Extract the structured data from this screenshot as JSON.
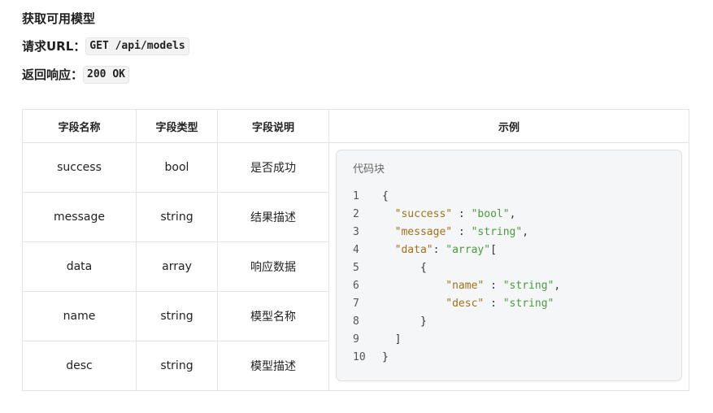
{
  "heading": "获取可用模型",
  "request": {
    "label": "请求URL：",
    "value": "GET /api/models"
  },
  "response": {
    "label": "返回响应：",
    "value": "200 OK"
  },
  "table": {
    "headers": [
      "字段名称",
      "字段类型",
      "字段说明",
      "示例"
    ],
    "rows": [
      [
        "success",
        "bool",
        "是否成功"
      ],
      [
        "message",
        "string",
        "结果描述"
      ],
      [
        "data",
        "array",
        "响应数据"
      ],
      [
        "name",
        "string",
        "模型名称"
      ],
      [
        "desc",
        "string",
        "模型描述"
      ]
    ]
  },
  "code_block": {
    "title": "代码块",
    "lines": [
      {
        "n": "1",
        "tokens": [
          {
            "t": "punc",
            "v": "{"
          }
        ]
      },
      {
        "n": "2",
        "tokens": [
          {
            "t": "punc",
            "v": "  "
          },
          {
            "t": "key",
            "v": "\"success\""
          },
          {
            "t": "punc",
            "v": " : "
          },
          {
            "t": "str",
            "v": "\"bool\""
          },
          {
            "t": "punc",
            "v": ","
          }
        ]
      },
      {
        "n": "3",
        "tokens": [
          {
            "t": "punc",
            "v": "  "
          },
          {
            "t": "key",
            "v": "\"message\""
          },
          {
            "t": "punc",
            "v": " : "
          },
          {
            "t": "str",
            "v": "\"string\""
          },
          {
            "t": "punc",
            "v": ","
          }
        ]
      },
      {
        "n": "4",
        "tokens": [
          {
            "t": "punc",
            "v": "  "
          },
          {
            "t": "key",
            "v": "\"data\""
          },
          {
            "t": "punc",
            "v": ": "
          },
          {
            "t": "str",
            "v": "\"array\""
          },
          {
            "t": "punc",
            "v": "["
          }
        ]
      },
      {
        "n": "5",
        "tokens": [
          {
            "t": "punc",
            "v": "      {"
          }
        ]
      },
      {
        "n": "6",
        "tokens": [
          {
            "t": "punc",
            "v": "          "
          },
          {
            "t": "key",
            "v": "\"name\""
          },
          {
            "t": "punc",
            "v": " : "
          },
          {
            "t": "str",
            "v": "\"string\""
          },
          {
            "t": "punc",
            "v": ","
          }
        ]
      },
      {
        "n": "7",
        "tokens": [
          {
            "t": "punc",
            "v": "          "
          },
          {
            "t": "key",
            "v": "\"desc\""
          },
          {
            "t": "punc",
            "v": " : "
          },
          {
            "t": "str",
            "v": "\"string\""
          }
        ]
      },
      {
        "n": "8",
        "tokens": [
          {
            "t": "punc",
            "v": "      }"
          }
        ]
      },
      {
        "n": "9",
        "tokens": [
          {
            "t": "punc",
            "v": "  ]"
          }
        ]
      },
      {
        "n": "10",
        "tokens": [
          {
            "t": "punc",
            "v": "}"
          }
        ]
      }
    ]
  }
}
